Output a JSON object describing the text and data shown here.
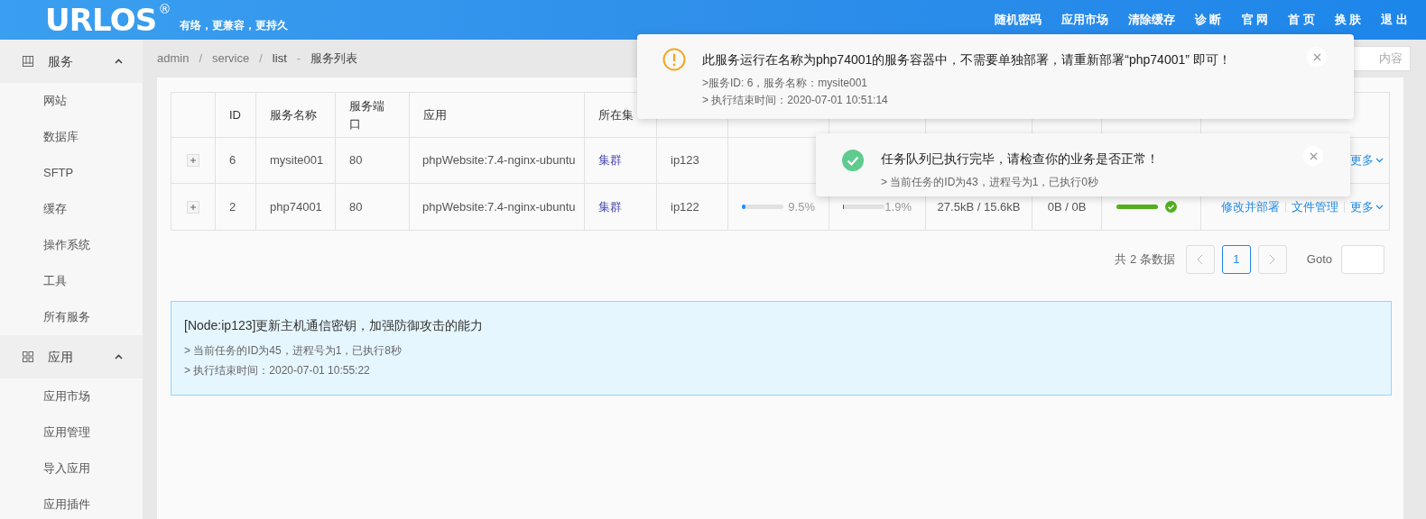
{
  "header": {
    "logo": "URLOS",
    "logo_mark": "®",
    "slogan": "有络，更兼容，更持久",
    "nav": [
      "随机密码",
      "应用市场",
      "清除缓存",
      "诊 断",
      "官 网",
      "首 页",
      "换 肤",
      "退 出"
    ]
  },
  "sidebar": {
    "groups": [
      {
        "label": "服务",
        "expanded": true,
        "items": [
          {
            "label": "网站",
            "selected": false
          },
          {
            "label": "数据库",
            "selected": false
          },
          {
            "label": "SFTP",
            "selected": false
          },
          {
            "label": "缓存",
            "selected": false
          },
          {
            "label": "操作系统",
            "selected": false
          },
          {
            "label": "工具",
            "selected": false
          },
          {
            "label": "所有服务",
            "selected": false
          }
        ]
      },
      {
        "label": "应用",
        "expanded": true,
        "items": [
          {
            "label": "应用市场",
            "selected": false
          },
          {
            "label": "应用管理",
            "selected": false
          },
          {
            "label": "导入应用",
            "selected": false
          },
          {
            "label": "应用插件",
            "selected": false
          }
        ]
      }
    ]
  },
  "breadcrumb": [
    {
      "kind": "link",
      "text": "admin"
    },
    {
      "kind": "separator",
      "text": "/"
    },
    {
      "kind": "link",
      "text": "service"
    },
    {
      "kind": "separator",
      "text": "/"
    },
    {
      "kind": "current",
      "text": "list"
    },
    {
      "kind": "separator",
      "text": "-"
    },
    {
      "kind": "title",
      "text": "服务列表"
    }
  ],
  "search": {
    "placeholder": "内容"
  },
  "table": {
    "columns": [
      "",
      "ID",
      "服务名称",
      "服务端口",
      "应用",
      "所在集"
    ],
    "rows": [
      {
        "id": "6",
        "name": "mysite001",
        "port": "80",
        "app": "phpWebsite:7.4-nginx-ubuntu",
        "cluster": "集群",
        "node": "ip123",
        "actions": [
          {
            "label": "更多",
            "dropdown": true
          }
        ]
      },
      {
        "id": "2",
        "name": "php74001",
        "port": "80",
        "app": "phpWebsite:7.4-nginx-ubuntu",
        "cluster": "集群",
        "node": "ip122",
        "cpu": {
          "level": 0.095,
          "reading": "9.5%"
        },
        "memory": {
          "level": 0.019,
          "reading": "1.9%"
        },
        "network": "27.5kB / 15.6kB",
        "disk": "0B / 0B",
        "status": {
          "level": 1,
          "ok": true
        },
        "actions": [
          {
            "label": "修改并部署",
            "dropdown": false
          },
          {
            "label": "文件管理",
            "dropdown": false
          },
          {
            "label": "更多",
            "dropdown": true
          }
        ]
      }
    ]
  },
  "pagination": {
    "total": "共 2 条数据",
    "pages": [
      {
        "label": "1",
        "selected": true
      }
    ],
    "goto": "Goto"
  },
  "info": {
    "title": "[Node:ip123]更新主机通信密钥，加强防御攻击的能力",
    "lines": [
      "> 当前任务的ID为45，进程号为1，已执行8秒",
      "> 执行结束时间：2020-07-01 10:55:22"
    ]
  },
  "notifications": [
    {
      "kind": "warning",
      "title": "此服务运行在名称为php74001的服务容器中，不需要单独部署，请重新部署“php74001” 即可！",
      "lines": [
        ">服务ID: 6，服务名称：mysite001",
        "> 执行结束时间：2020-07-01 10:51:14"
      ]
    },
    {
      "kind": "success",
      "title": "任务队列已执行完毕，请检查你的业务是否正常！",
      "lines": [
        "> 当前任务的ID为43，进程号为1，已执行0秒"
      ]
    }
  ]
}
